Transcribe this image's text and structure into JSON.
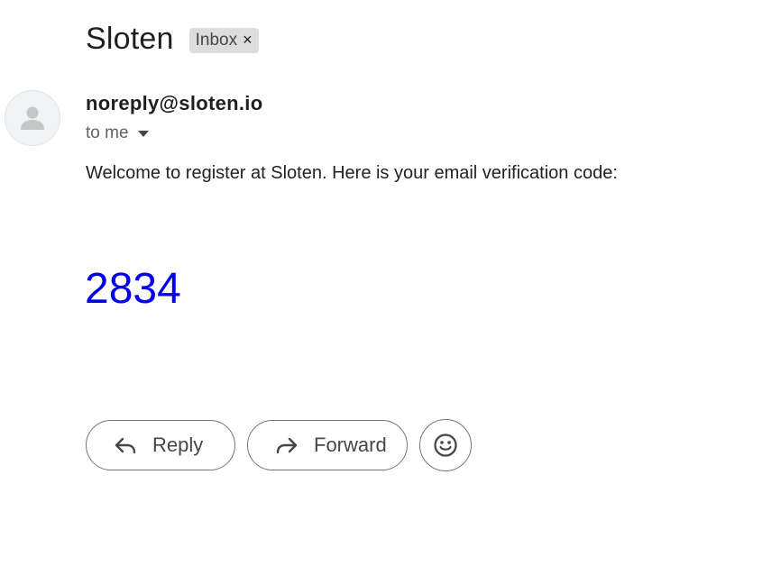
{
  "email": {
    "subject": "Sloten",
    "label": "Inbox",
    "label_remove": "×",
    "sender": "noreply@sloten.io",
    "recipient": "to me",
    "body": "Welcome to register at Sloten. Here is your email verification code:",
    "code": "2834"
  },
  "actions": {
    "reply_label": "Reply",
    "forward_label": "Forward"
  },
  "icons": {
    "avatar": "person-icon",
    "recipient_dropdown": "caret-down-icon",
    "reply": "reply-arrow-icon",
    "forward": "forward-arrow-icon",
    "emoji": "smiley-icon"
  },
  "colors": {
    "code": "#0000ee",
    "chip_background": "#dddddd",
    "button_border": "#747775"
  }
}
